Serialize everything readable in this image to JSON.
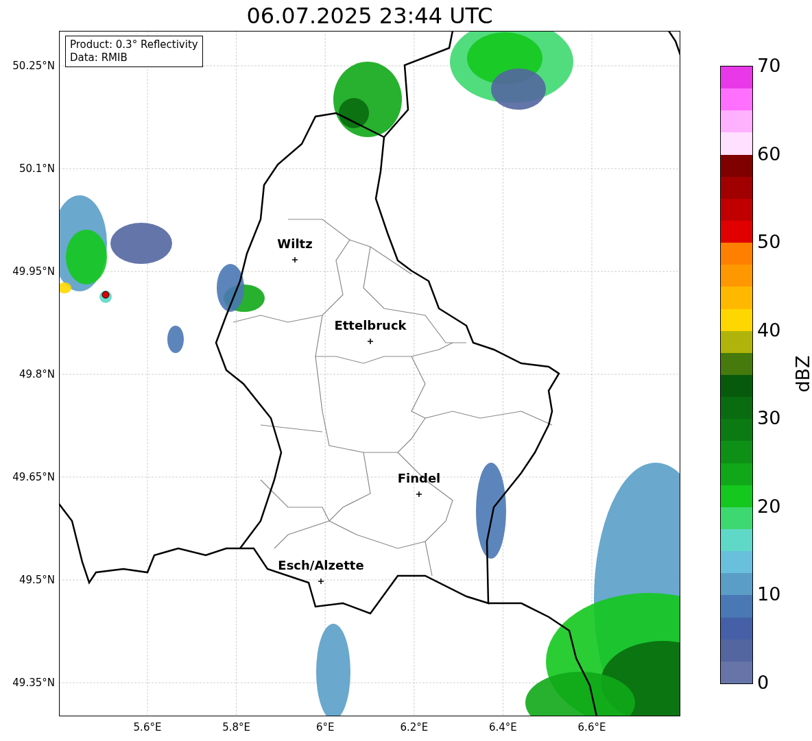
{
  "title": "06.07.2025 23:44 UTC",
  "info_box": [
    "Product: 0.3° Reflectivity",
    "Data: RMIB"
  ],
  "map": {
    "lat_ticks": [
      "50.25°N",
      "50.1°N",
      "49.95°N",
      "49.8°N",
      "49.65°N",
      "49.5°N",
      "49.35°N"
    ],
    "lon_ticks": [
      "5.6°E",
      "5.8°E",
      "6°E",
      "6.2°E",
      "6.4°E",
      "6.6°E"
    ],
    "cities": [
      {
        "name": "Wiltz"
      },
      {
        "name": "Ettelbruck"
      },
      {
        "name": "Findel"
      },
      {
        "name": "Esch/Alzette"
      }
    ]
  },
  "colorbar": {
    "label": "dBZ",
    "ticks": [
      "70",
      "60",
      "50",
      "40",
      "30",
      "20",
      "10",
      "0"
    ],
    "bands": [
      {
        "color": "#e838e8"
      },
      {
        "color": "#ff70ff"
      },
      {
        "color": "#ffb0ff"
      },
      {
        "color": "#ffe0ff"
      },
      {
        "color": "#800000"
      },
      {
        "color": "#a00000"
      },
      {
        "color": "#c00000"
      },
      {
        "color": "#e00000"
      },
      {
        "color": "#ff7f00"
      },
      {
        "color": "#ff9800"
      },
      {
        "color": "#ffb800"
      },
      {
        "color": "#ffd700"
      },
      {
        "color": "#b0b40a"
      },
      {
        "color": "#467a0c"
      },
      {
        "color": "#075a0c"
      },
      {
        "color": "#0a6c10"
      },
      {
        "color": "#0c7a12"
      },
      {
        "color": "#0e9016"
      },
      {
        "color": "#10a818"
      },
      {
        "color": "#14c81e"
      },
      {
        "color": "#3ed870"
      },
      {
        "color": "#60d8c8"
      },
      {
        "color": "#68c0dc"
      },
      {
        "color": "#5a9ec8"
      },
      {
        "color": "#4a78b4"
      },
      {
        "color": "#4560a6"
      },
      {
        "color": "#5366a0"
      },
      {
        "color": "#6674a8"
      }
    ]
  }
}
